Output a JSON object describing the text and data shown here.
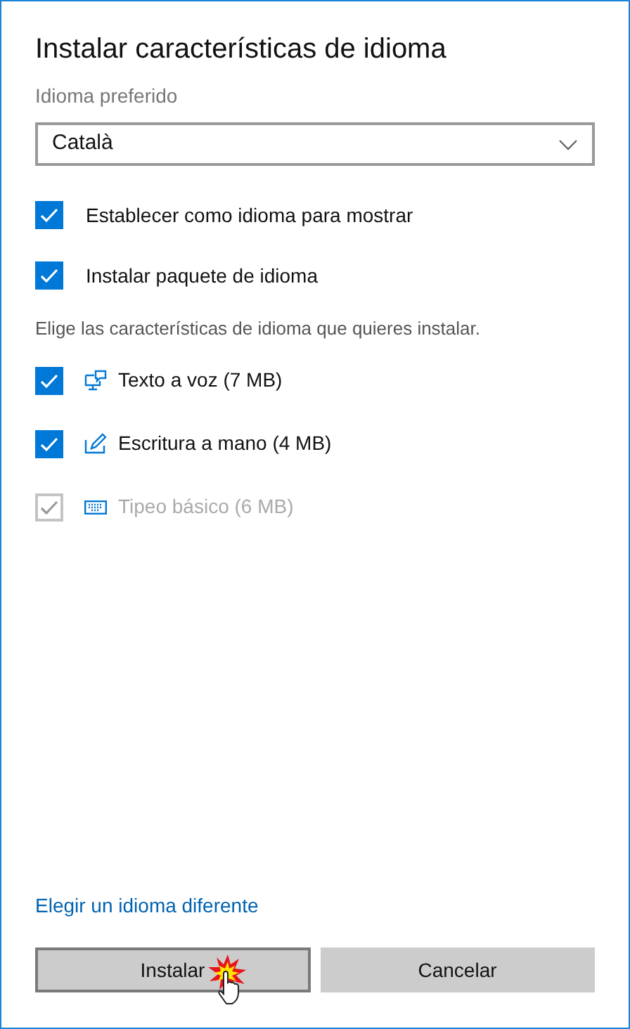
{
  "dialog": {
    "title": "Instalar características de idioma"
  },
  "preferred_language": {
    "label": "Idioma preferido",
    "value": "Català"
  },
  "options": [
    {
      "label": "Establecer como idioma para mostrar",
      "checked": true
    },
    {
      "label": "Instalar paquete de idioma",
      "checked": true
    }
  ],
  "features_intro": "Elige las características de idioma que quieres instalar.",
  "features": [
    {
      "label": "Texto a voz (7 MB)",
      "checked": true,
      "disabled": false,
      "kind": "speech"
    },
    {
      "label": "Escritura a mano (4 MB)",
      "checked": true,
      "disabled": false,
      "kind": "handwriting"
    },
    {
      "label": "Tipeo básico (6 MB)",
      "checked": true,
      "disabled": true,
      "kind": "keyboard"
    }
  ],
  "link": "Elegir un idioma diferente",
  "buttons": [
    {
      "label": "Instalar",
      "focused": true
    },
    {
      "label": "Cancelar",
      "focused": false
    }
  ]
}
